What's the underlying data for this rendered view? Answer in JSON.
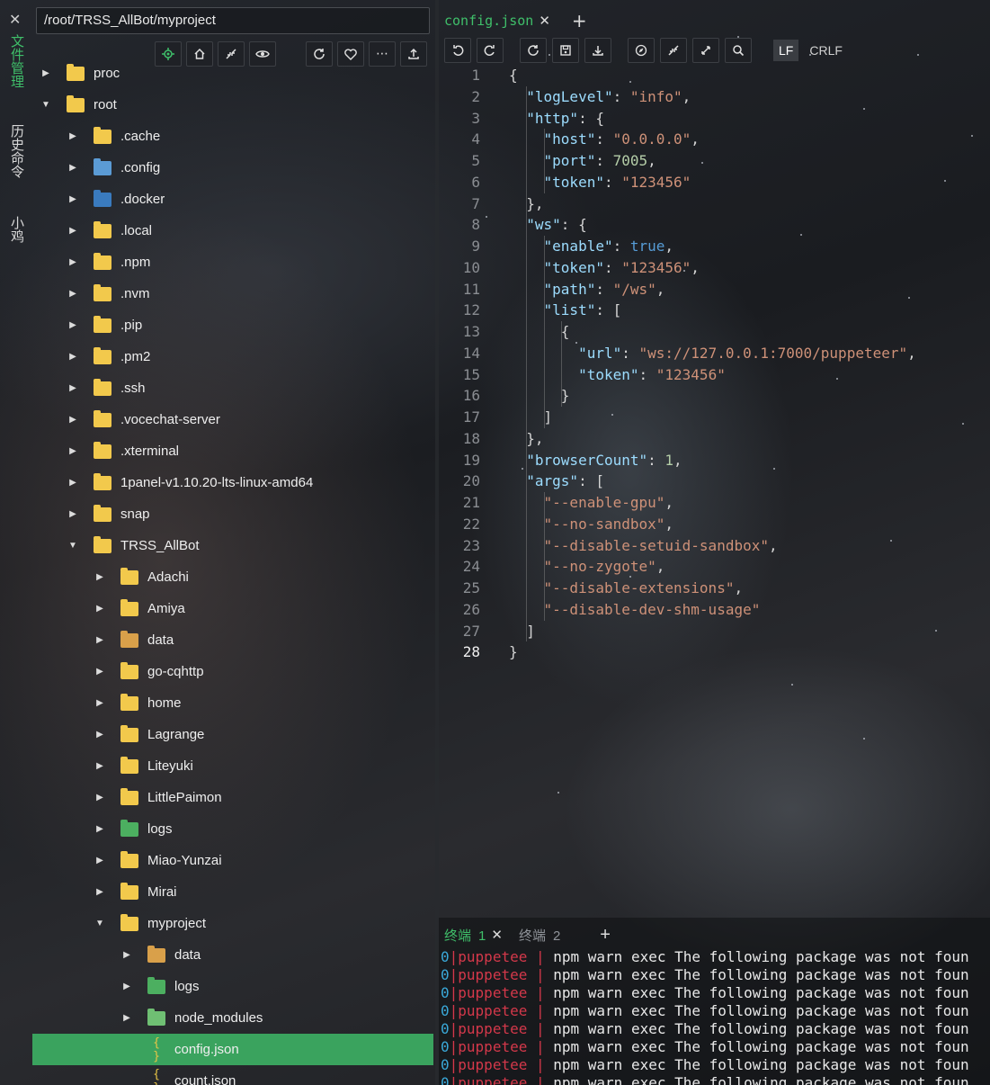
{
  "sidebar_tabs": [
    "文件管理",
    "历史命令",
    "小鸡"
  ],
  "file_panel": {
    "path": "/root/TRSS_AllBot/myproject",
    "toolbar_icons": [
      "locate-icon",
      "home-icon",
      "collapse-icon",
      "eye-icon",
      "refresh-icon",
      "heart-icon",
      "more-icon",
      "upload-icon"
    ],
    "tree": [
      {
        "name": "proc",
        "depth": 0,
        "expanded": false,
        "icon": "folder"
      },
      {
        "name": "root",
        "depth": 0,
        "expanded": true,
        "icon": "folder"
      },
      {
        "name": ".cache",
        "depth": 1,
        "expanded": false,
        "icon": "folder"
      },
      {
        "name": ".config",
        "depth": 1,
        "expanded": false,
        "icon": "folder-config"
      },
      {
        "name": ".docker",
        "depth": 1,
        "expanded": false,
        "icon": "folder-docker"
      },
      {
        "name": ".local",
        "depth": 1,
        "expanded": false,
        "icon": "folder"
      },
      {
        "name": ".npm",
        "depth": 1,
        "expanded": false,
        "icon": "folder"
      },
      {
        "name": ".nvm",
        "depth": 1,
        "expanded": false,
        "icon": "folder"
      },
      {
        "name": ".pip",
        "depth": 1,
        "expanded": false,
        "icon": "folder"
      },
      {
        "name": ".pm2",
        "depth": 1,
        "expanded": false,
        "icon": "folder"
      },
      {
        "name": ".ssh",
        "depth": 1,
        "expanded": false,
        "icon": "folder"
      },
      {
        "name": ".vocechat-server",
        "depth": 1,
        "expanded": false,
        "icon": "folder"
      },
      {
        "name": ".xterminal",
        "depth": 1,
        "expanded": false,
        "icon": "folder"
      },
      {
        "name": "1panel-v1.10.20-lts-linux-amd64",
        "depth": 1,
        "expanded": false,
        "icon": "folder"
      },
      {
        "name": "snap",
        "depth": 1,
        "expanded": false,
        "icon": "folder"
      },
      {
        "name": "TRSS_AllBot",
        "depth": 1,
        "expanded": true,
        "icon": "folder"
      },
      {
        "name": "Adachi",
        "depth": 2,
        "expanded": false,
        "icon": "folder"
      },
      {
        "name": "Amiya",
        "depth": 2,
        "expanded": false,
        "icon": "folder"
      },
      {
        "name": "data",
        "depth": 2,
        "expanded": false,
        "icon": "folder-data"
      },
      {
        "name": "go-cqhttp",
        "depth": 2,
        "expanded": false,
        "icon": "folder"
      },
      {
        "name": "home",
        "depth": 2,
        "expanded": false,
        "icon": "folder"
      },
      {
        "name": "Lagrange",
        "depth": 2,
        "expanded": false,
        "icon": "folder"
      },
      {
        "name": "Liteyuki",
        "depth": 2,
        "expanded": false,
        "icon": "folder"
      },
      {
        "name": "LittlePaimon",
        "depth": 2,
        "expanded": false,
        "icon": "folder"
      },
      {
        "name": "logs",
        "depth": 2,
        "expanded": false,
        "icon": "folder-logs"
      },
      {
        "name": "Miao-Yunzai",
        "depth": 2,
        "expanded": false,
        "icon": "folder"
      },
      {
        "name": "Mirai",
        "depth": 2,
        "expanded": false,
        "icon": "folder"
      },
      {
        "name": "myproject",
        "depth": 2,
        "expanded": true,
        "icon": "folder"
      },
      {
        "name": "data",
        "depth": 3,
        "expanded": false,
        "icon": "folder-data"
      },
      {
        "name": "logs",
        "depth": 3,
        "expanded": false,
        "icon": "folder-logs"
      },
      {
        "name": "node_modules",
        "depth": 3,
        "expanded": false,
        "icon": "folder-node"
      },
      {
        "name": "config.json",
        "depth": 3,
        "expanded": null,
        "icon": "json",
        "selected": true
      },
      {
        "name": "count.json",
        "depth": 3,
        "expanded": null,
        "icon": "json"
      }
    ]
  },
  "editor": {
    "tab": "config.json",
    "toolbar_icons": [
      "undo-icon",
      "redo-icon",
      "refresh-icon",
      "save-icon",
      "download-icon",
      "compass-icon",
      "collapse-icon",
      "expand-icon",
      "search-icon"
    ],
    "eol_options": [
      "LF",
      "CRLF"
    ],
    "eol_selected": "LF",
    "current_line": 28,
    "lines": [
      "{",
      "  \"logLevel\": \"info\",",
      "  \"http\": {",
      "    \"host\": \"0.0.0.0\",",
      "    \"port\": 7005,",
      "    \"token\": \"123456\"",
      "  },",
      "  \"ws\": {",
      "    \"enable\": true,",
      "    \"token\": \"123456\",",
      "    \"path\": \"/ws\",",
      "    \"list\": [",
      "      {",
      "        \"url\": \"ws://127.0.0.1:7000/puppeteer\",",
      "        \"token\": \"123456\"",
      "      }",
      "    ]",
      "  },",
      "  \"browserCount\": 1,",
      "  \"args\": [",
      "    \"--enable-gpu\",",
      "    \"--no-sandbox\",",
      "    \"--disable-setuid-sandbox\",",
      "    \"--no-zygote\",",
      "    \"--disable-extensions\",",
      "    \"--disable-dev-shm-usage\"",
      "  ]",
      "}"
    ]
  },
  "terminal": {
    "tabs": [
      {
        "label": "终端",
        "number": "1",
        "active": true
      },
      {
        "label": "终端",
        "number": "2",
        "active": false
      }
    ],
    "lines": [
      {
        "id": "0",
        "proc": "puppetee",
        "msg": "npm warn exec The following package was not foun"
      },
      {
        "id": "0",
        "proc": "puppetee",
        "msg": "npm warn exec The following package was not foun"
      },
      {
        "id": "0",
        "proc": "puppetee",
        "msg": "npm warn exec The following package was not foun"
      },
      {
        "id": "0",
        "proc": "puppetee",
        "msg": "npm warn exec The following package was not foun"
      },
      {
        "id": "0",
        "proc": "puppetee",
        "msg": "npm warn exec The following package was not foun"
      },
      {
        "id": "0",
        "proc": "puppetee",
        "msg": "npm warn exec The following package was not foun"
      },
      {
        "id": "0",
        "proc": "puppetee",
        "msg": "npm warn exec The following package was not foun"
      },
      {
        "id": "0",
        "proc": "puppetee",
        "msg": "npm warn exec The following package was not foun"
      }
    ]
  },
  "colors": {
    "accent": "#3fbf6a",
    "selected_row": "#3aa35e",
    "json_key": "#9cdcfe",
    "json_string": "#ce9178",
    "json_number": "#b5cea8",
    "json_bool": "#569cd6",
    "terminal_proc": "#d4384a",
    "terminal_id": "#3aa8d8"
  }
}
